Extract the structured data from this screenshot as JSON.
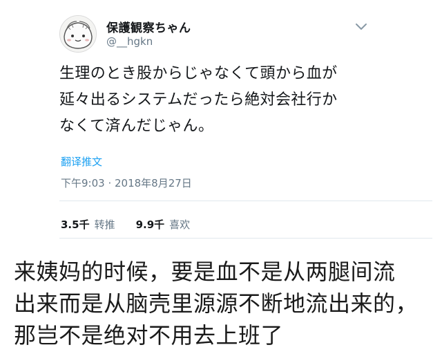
{
  "tweet": {
    "avatar_icon": "doodle-face-avatar-icon",
    "display_name": "保護観察ちゃん",
    "handle": "@__hgkn",
    "menu_icon": "chevron-down-icon",
    "text": "生理のとき股からじゃなくて頭から血が\n延々出るシステムだったら絶対会社行か\nなくて済んだじゃん。",
    "translate_label": "翻译推文",
    "timestamp": "下午9:03 · 2018年8月27日",
    "stats": [
      {
        "count": "3.5千",
        "label": "转推"
      },
      {
        "count": "9.9千",
        "label": "喜欢"
      }
    ],
    "colors": {
      "link": "#1da1f2",
      "muted": "#657786",
      "text": "#14171a",
      "divider": "#e1e8ed"
    }
  },
  "caption": {
    "text": "来姨妈的时候，要是血不是从两腿间流\n出来而是从脑壳里源源不断地流出来的，\n那岂不是绝对不用去上班了"
  }
}
